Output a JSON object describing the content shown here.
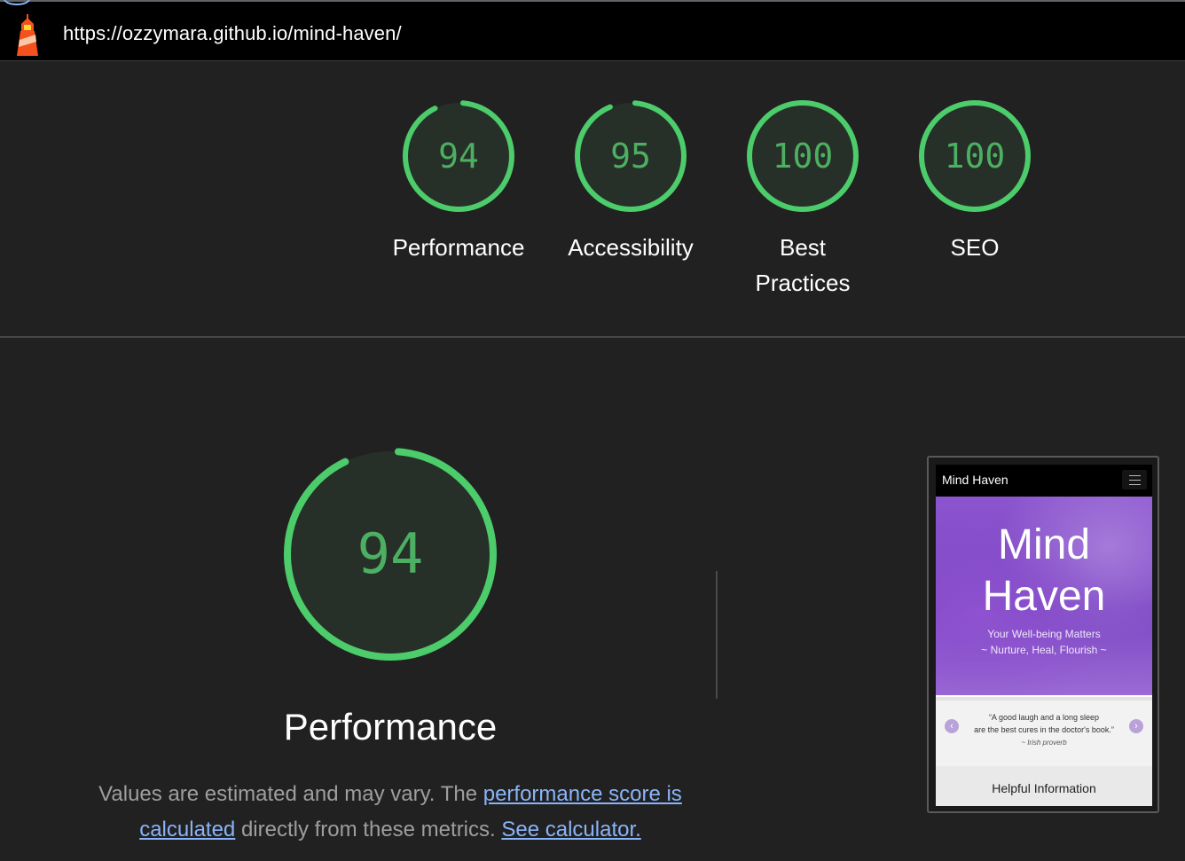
{
  "topbar": {
    "url": "https://ozzymara.github.io/mind-haven/",
    "logo_icon": "lighthouse-icon"
  },
  "summary": {
    "gauges": [
      {
        "score": "94",
        "label": "Performance",
        "fraction": 0.94
      },
      {
        "score": "95",
        "label": "Accessibility",
        "fraction": 0.95
      },
      {
        "score": "100",
        "label": "Best Practices",
        "fraction": 1.0
      },
      {
        "score": "100",
        "label": "SEO",
        "fraction": 1.0
      }
    ]
  },
  "performance": {
    "score": "94",
    "fraction": 0.94,
    "title": "Performance",
    "desc_prefix": "Values are estimated and may vary. The ",
    "desc_link": "performance score is calculated",
    "desc_middle": " directly from these metrics. ",
    "desc_calculator": "See calculator."
  },
  "screenshot": {
    "brand": "Mind Haven",
    "hero_title_line1": "Mind",
    "hero_title_line2": "Haven",
    "tagline1": "Your Well-being Matters",
    "tagline2": "~ Nurture, Heal, Flourish ~",
    "quote_line1": "“A good laugh and a long sleep",
    "quote_line2": "are the best cures in the doctor's book.”",
    "quote_author": "~ Irish proverb",
    "helpful": "Helpful Information"
  },
  "colors": {
    "pass_green": "#0cce6b",
    "gauge_green": "#4caf61",
    "link_blue": "#8ab4f8",
    "background": "#212121"
  }
}
